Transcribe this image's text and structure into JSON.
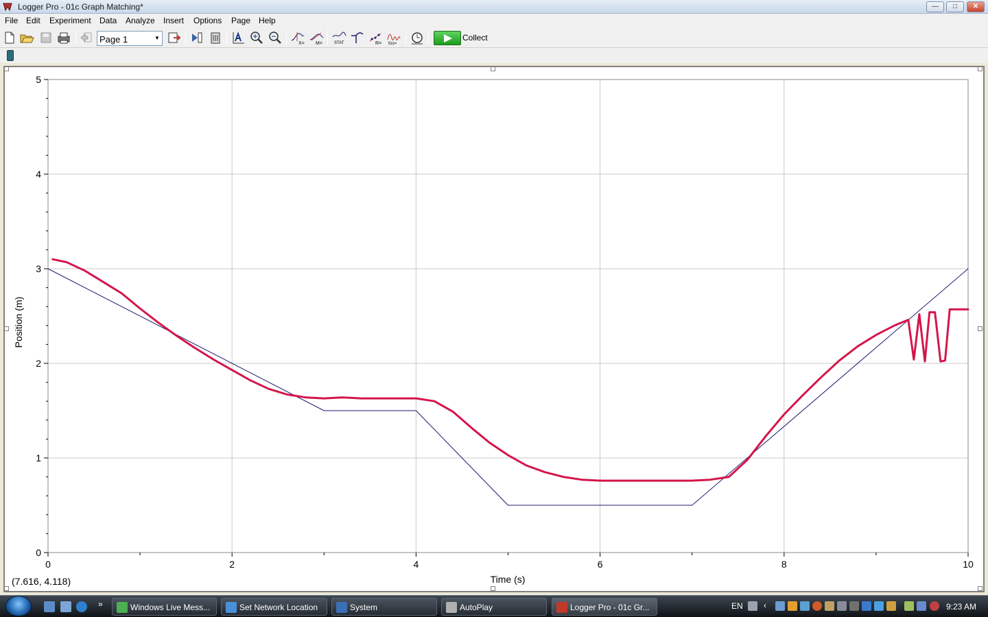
{
  "window": {
    "title": "Logger Pro - 01c Graph Matching*",
    "min_label": "—",
    "max_label": "□",
    "close_label": "✕"
  },
  "menu": [
    "File",
    "Edit",
    "Experiment",
    "Data",
    "Analyze",
    "Insert",
    "Options",
    "Page",
    "Help"
  ],
  "toolbar": {
    "page_select": "Page 1",
    "collect_label": "Collect",
    "icons": [
      "new-file-icon",
      "open-file-icon",
      "save-icon",
      "print-icon",
      "page-back-icon",
      "page-setup-icon",
      "next-page-icon",
      "data-browser-icon",
      "autoscale-icon",
      "zoom-in-icon",
      "zoom-out-icon",
      "examine-icon",
      "tangent-icon",
      "integral-icon",
      "statistics-icon",
      "linear-fit-icon",
      "curve-fit-icon",
      "model-icon",
      "timer-icon",
      "collect-icon"
    ]
  },
  "graph": {
    "readout": "(7.616, 4.118)",
    "colors": {
      "target_line": "#1a1a6e",
      "data_line": "#d4154a",
      "grid": "#c8c8c8"
    }
  },
  "chart_data": {
    "type": "line",
    "title": "",
    "xlabel": "Time (s)",
    "ylabel": "Position (m)",
    "xlim": [
      0,
      10
    ],
    "ylim": [
      0,
      5
    ],
    "x_ticks": [
      0,
      2,
      4,
      6,
      8,
      10
    ],
    "y_ticks": [
      0,
      1,
      2,
      3,
      4,
      5
    ],
    "grid": true,
    "series": [
      {
        "color": "#1a1a6e",
        "x": [
          0,
          3,
          4,
          5,
          7,
          10
        ],
        "y": [
          3.0,
          1.5,
          1.5,
          0.5,
          0.5,
          3.0
        ]
      },
      {
        "color": "#d4154a",
        "x": [
          0.05,
          0.2,
          0.4,
          0.6,
          0.8,
          1.0,
          1.2,
          1.4,
          1.6,
          1.8,
          2.0,
          2.2,
          2.4,
          2.6,
          2.8,
          3.0,
          3.2,
          3.4,
          3.6,
          3.8,
          4.0,
          4.2,
          4.4,
          4.6,
          4.8,
          5.0,
          5.2,
          5.4,
          5.6,
          5.8,
          6.0,
          6.2,
          6.4,
          6.6,
          6.8,
          7.0,
          7.2,
          7.4,
          7.6,
          7.8,
          8.0,
          8.2,
          8.4,
          8.6,
          8.8,
          9.0,
          9.2,
          9.35,
          9.41,
          9.47,
          9.53,
          9.58,
          9.64,
          9.7,
          9.75,
          9.8,
          9.9,
          10.0
        ],
        "y": [
          3.1,
          3.07,
          2.98,
          2.86,
          2.74,
          2.58,
          2.43,
          2.29,
          2.16,
          2.04,
          1.93,
          1.82,
          1.73,
          1.67,
          1.64,
          1.63,
          1.64,
          1.63,
          1.63,
          1.63,
          1.63,
          1.6,
          1.49,
          1.32,
          1.16,
          1.03,
          0.92,
          0.85,
          0.8,
          0.77,
          0.76,
          0.76,
          0.76,
          0.76,
          0.76,
          0.76,
          0.77,
          0.8,
          0.98,
          1.23,
          1.46,
          1.66,
          1.85,
          2.03,
          2.18,
          2.3,
          2.4,
          2.46,
          2.04,
          2.52,
          2.02,
          2.54,
          2.54,
          2.02,
          2.03,
          2.57,
          2.57,
          2.57
        ]
      }
    ]
  },
  "taskbar": {
    "tasks": [
      {
        "label": "Windows Live Mess...",
        "icon": "messenger-icon",
        "color": "#4caf50"
      },
      {
        "label": "Set Network Location",
        "icon": "network-icon",
        "color": "#4a90d9"
      },
      {
        "label": "System",
        "icon": "system-icon",
        "color": "#3b6fb6"
      },
      {
        "label": "AutoPlay",
        "icon": "autoplay-icon",
        "color": "#b0b0b0"
      },
      {
        "label": "Logger Pro - 01c Gr...",
        "icon": "logger-pro-icon",
        "color": "#c0392b"
      }
    ],
    "language": "EN",
    "clock": "9:23 AM"
  }
}
